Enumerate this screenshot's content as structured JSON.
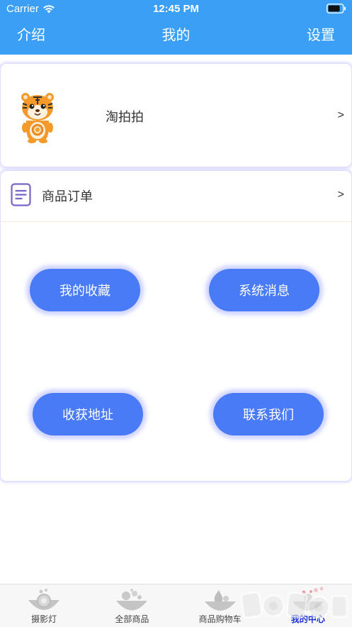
{
  "status_bar": {
    "carrier": "Carrier",
    "time": "12:45 PM",
    "icons": [
      "wifi-icon",
      "battery-icon"
    ]
  },
  "nav": {
    "left": "介绍",
    "title": "我的",
    "right": "设置"
  },
  "profile": {
    "name": "淘拍拍",
    "chevron": ">",
    "avatar": "tiger-mascot"
  },
  "orders": {
    "label": "商品订单",
    "chevron": ">",
    "icon": "document-icon"
  },
  "actions": [
    {
      "label": "我的收藏"
    },
    {
      "label": "系统消息"
    },
    {
      "label": "收获地址"
    },
    {
      "label": "联系我们"
    }
  ],
  "tabs": [
    {
      "label": "摄影灯",
      "icon": "lamp-icon",
      "selected": false
    },
    {
      "label": "全部商品",
      "icon": "products-icon",
      "selected": false
    },
    {
      "label": "商品购物车",
      "icon": "cart-icon",
      "selected": false
    },
    {
      "label": "我的中心",
      "icon": "profile-icon",
      "selected": true
    }
  ],
  "colors": {
    "header": "#3ba0f5",
    "button": "#4a7bf7",
    "tab_selected": "#1a2fd0",
    "card_shadow": "#afafff"
  }
}
